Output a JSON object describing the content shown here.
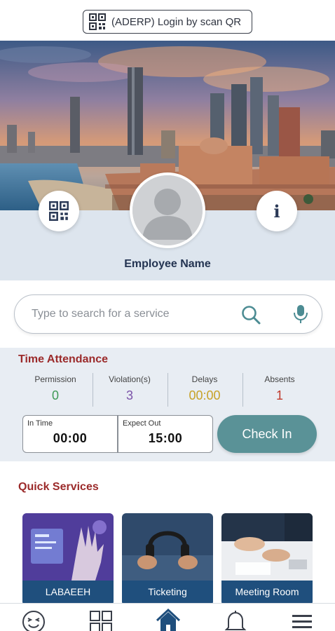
{
  "top": {
    "qr_login_label": "(ADERP) Login by scan QR"
  },
  "hero": {
    "info_label": "i"
  },
  "profile": {
    "employee_name": "Employee Name"
  },
  "search": {
    "placeholder": "Type to search for a service"
  },
  "time_attendance": {
    "title": "Time Attendance",
    "stats": [
      {
        "label": "Permission",
        "value": "0",
        "color": "#3f9a57"
      },
      {
        "label": "Violation(s)",
        "value": "3",
        "color": "#7b53a8"
      },
      {
        "label": "Delays",
        "value": "00:00",
        "color": "#c7a227"
      },
      {
        "label": "Absents",
        "value": "1",
        "color": "#c0392b"
      }
    ],
    "in_time_label": "In Time",
    "in_time_value": "00:00",
    "expect_out_label": "Expect Out",
    "expect_out_value": "15:00",
    "check_in_label": "Check In"
  },
  "quick_services": {
    "title": "Quick Services",
    "cards": [
      {
        "caption": "LABAEEH"
      },
      {
        "caption": "Ticketing"
      },
      {
        "caption": "Meeting Room"
      }
    ]
  },
  "colors": {
    "accent_red": "#9b2a2a",
    "check_in_bg": "#5a9297",
    "card_caption_bg": "#1f4f7d",
    "nav_active": "#1f4f7d"
  },
  "nav_icons": [
    "smiley-icon",
    "grid-icon",
    "home-icon",
    "bell-icon",
    "menu-icon"
  ]
}
